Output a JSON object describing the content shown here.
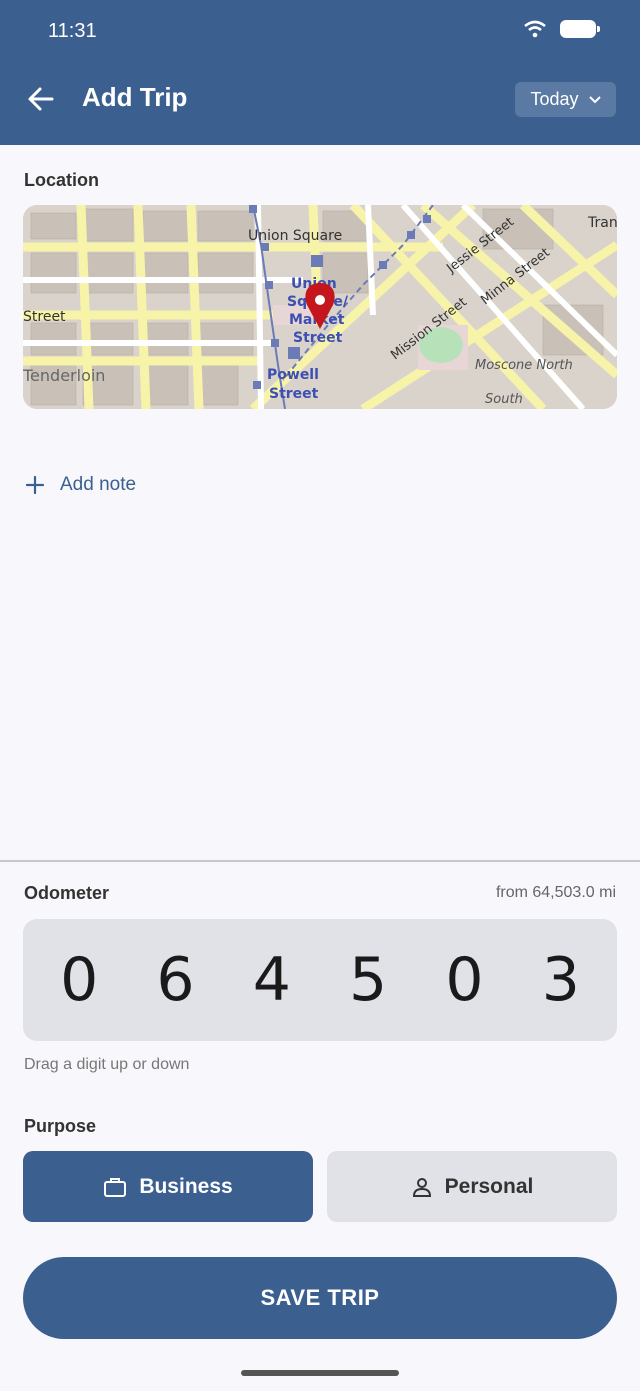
{
  "status_bar": {
    "time": "11:31"
  },
  "appbar": {
    "title": "Add Trip",
    "date_selector": "Today"
  },
  "location": {
    "label": "Location",
    "map_labels": [
      "Union Square",
      "Union Square/Market Street",
      "Powell Street",
      "Mission Street",
      "Jessie Street",
      "Minna Street",
      "Moscone North",
      "South",
      "Tenderloin",
      "Street",
      "Tran"
    ]
  },
  "note": {
    "add_label": "Add note"
  },
  "odometer": {
    "label": "Odometer",
    "from_text": "from 64,503.0 mi",
    "digits": [
      "0",
      "6",
      "4",
      "5",
      "0",
      "3"
    ],
    "hint": "Drag a digit up or down"
  },
  "purpose": {
    "label": "Purpose",
    "options": [
      {
        "label": "Business",
        "icon": "briefcase-icon",
        "selected": true
      },
      {
        "label": "Personal",
        "icon": "person-icon",
        "selected": false
      }
    ]
  },
  "save": {
    "label": "SAVE TRIP"
  },
  "colors": {
    "primary": "#3b5f8f",
    "surface": "#f8f8fc",
    "chip": "#e1e2e8",
    "pin": "#c4161c"
  }
}
